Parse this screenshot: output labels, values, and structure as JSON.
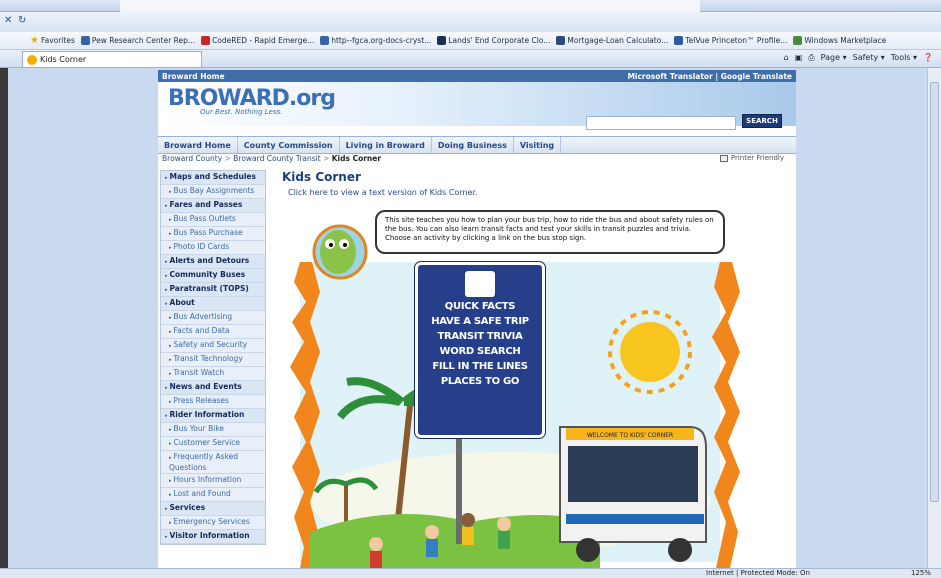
{
  "browser": {
    "tab_title": "Kids Corner",
    "favorites_label": "Favorites",
    "favorites": [
      {
        "label": "Pew Research Center Rep...",
        "icon": "news-icon",
        "color": "#3a64a8"
      },
      {
        "label": "CodeRED - Rapid Emerge...",
        "icon": "codered-icon",
        "color": "#c8262a"
      },
      {
        "label": "http--fgca.org-docs-cryst...",
        "icon": "page-icon",
        "color": "#3a64a8"
      },
      {
        "label": "Lands' End Corporate Clo...",
        "icon": "store-icon",
        "color": "#1b2f57"
      },
      {
        "label": "Mortgage-Loan Calculato...",
        "icon": "calculator-icon",
        "color": "#2d4b7c"
      },
      {
        "label": "TelVue Princeton™ Profile...",
        "icon": "v-icon",
        "color": "#2d5aa0"
      },
      {
        "label": "Windows Marketplace",
        "icon": "windows-icon",
        "color": "#4a8b3a"
      }
    ],
    "command_bar": [
      "Page ▾",
      "Safety ▾",
      "Tools ▾"
    ],
    "status_zone": "Internet | Protected Mode: On",
    "status_zoom": "125%"
  },
  "site": {
    "top_left": "Broward Home",
    "top_right": "Microsoft Translator | Google Translate",
    "logo_text": "BROWARD.org",
    "logo_tagline": "Our Best. Nothing Less.",
    "search_button": "SEARCH",
    "main_nav": [
      "Broward Home",
      "County Commission",
      "Living in Broward",
      "Doing Business",
      "Visiting"
    ],
    "breadcrumb": {
      "crumb1": "Broward County",
      "crumb2": "Broward County Transit",
      "current": "Kids Corner",
      "sep": " > "
    },
    "printer_friendly": "Printer Friendly"
  },
  "sidebar": [
    {
      "label": "Maps and Schedules",
      "type": "head"
    },
    {
      "label": "Bus Bay Assignments",
      "type": "sub"
    },
    {
      "label": "Fares and Passes",
      "type": "head"
    },
    {
      "label": "Bus Pass Outlets",
      "type": "sub"
    },
    {
      "label": "Bus Pass Purchase",
      "type": "sub"
    },
    {
      "label": "Photo ID Cards",
      "type": "sub"
    },
    {
      "label": "Alerts and Detours",
      "type": "head"
    },
    {
      "label": "Community Buses",
      "type": "head"
    },
    {
      "label": "Paratransit (TOPS)",
      "type": "head"
    },
    {
      "label": "About",
      "type": "head"
    },
    {
      "label": "Bus Advertising",
      "type": "sub"
    },
    {
      "label": "Facts and Data",
      "type": "sub"
    },
    {
      "label": "Safety and Security",
      "type": "sub"
    },
    {
      "label": "Transit Technology",
      "type": "sub"
    },
    {
      "label": "Transit Watch",
      "type": "sub"
    },
    {
      "label": "News and Events",
      "type": "head"
    },
    {
      "label": "Press Releases",
      "type": "sub"
    },
    {
      "label": "Rider Information",
      "type": "head"
    },
    {
      "label": "Bus Your Bike",
      "type": "sub"
    },
    {
      "label": "Customer Service",
      "type": "sub"
    },
    {
      "label": "Frequently Asked Questions",
      "type": "sub"
    },
    {
      "label": "Hours Information",
      "type": "sub"
    },
    {
      "label": "Lost and Found",
      "type": "sub"
    },
    {
      "label": "Services",
      "type": "head"
    },
    {
      "label": "Emergency Services",
      "type": "sub"
    },
    {
      "label": "Visitor Information",
      "type": "head"
    }
  ],
  "main": {
    "title": "Kids Corner",
    "text_version_link": "Click here to view a text version of Kids Corner.",
    "bubble_text": "This site teaches you how to plan your bus trip, how to ride the bus and about safety rules on the bus. You can also learn transit facts and test your skills in transit puzzles and trivia. Choose an activity by clicking a link on the bus stop sign.",
    "sign_items": [
      "QUICK FACTS",
      "HAVE A SAFE TRIP",
      "TRANSIT TRIVIA",
      "WORD SEARCH",
      "FILL IN THE LINES",
      "PLACES TO GO"
    ],
    "bus_marquee": "WELCOME TO KIDS' CORNER"
  }
}
